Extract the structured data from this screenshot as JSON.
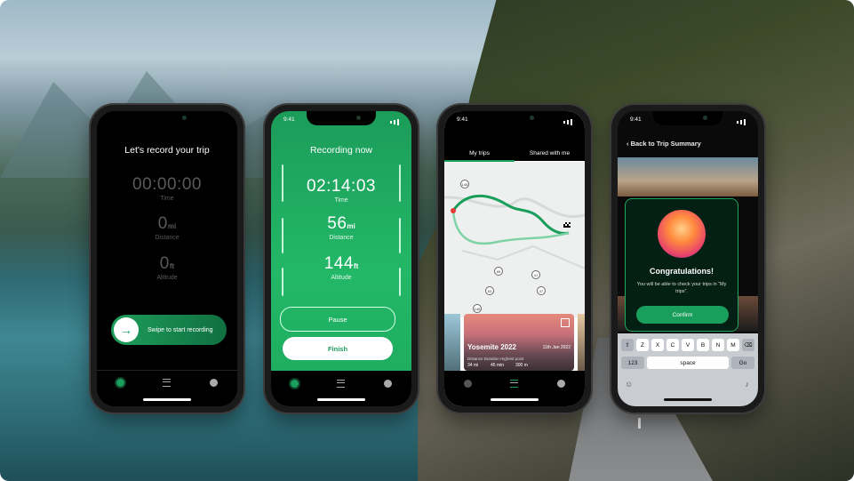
{
  "phone1": {
    "title": "Let's record your trip",
    "time": "00:00:00",
    "time_label": "Time",
    "distance": "0",
    "distance_unit": "mi",
    "distance_label": "Distance",
    "altitude": "0",
    "altitude_unit": "ft",
    "altitude_label": "Altitude",
    "swipe_label": "Swipe to start recording"
  },
  "phone2": {
    "clock": "9:41",
    "title": "Recording now",
    "time": "02:14:03",
    "time_label": "Time",
    "distance": "56",
    "distance_unit": "mi",
    "distance_label": "Distance",
    "altitude": "144",
    "altitude_unit": "ft",
    "altitude_label": "Altitude",
    "pause_label": "Pause",
    "finish_label": "Finish"
  },
  "phone3": {
    "clock": "9:41",
    "tabs": [
      "My trips",
      "Shared with me"
    ],
    "card": {
      "title": "Yosemite 2022",
      "date": "11th Jan 2022",
      "distance_label": "Distance",
      "duration_label": "Duration",
      "highest_label": "Highest point",
      "distance": "34 mi",
      "duration": "45 min",
      "highest": "300 m"
    },
    "map_labels": [
      "146",
      "89",
      "63",
      "41",
      "47",
      "146"
    ]
  },
  "phone4": {
    "clock": "9:41",
    "back_label": "Back to Trip Summary",
    "congrats": "Congratulations!",
    "message": "You will be able to check your trips in “My trips”.",
    "confirm_label": "Confirm",
    "keyboard": {
      "row1": [
        "Z",
        "X",
        "C",
        "V",
        "B",
        "N",
        "M"
      ],
      "num": "123",
      "space": "space",
      "go": "Go"
    }
  },
  "colors": {
    "accent": "#1a9e5c",
    "accent_light": "#22b867"
  }
}
